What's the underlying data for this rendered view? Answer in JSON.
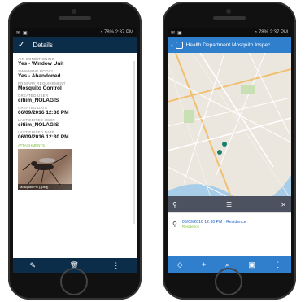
{
  "left_phone": {
    "status": {
      "time": "2:37 PM",
      "battery": "78%"
    },
    "header": {
      "title": "Details"
    },
    "fields": [
      {
        "label": "AIR CONDITIONING",
        "value": "Yes - Window Unit"
      },
      {
        "label": "SWIMMING POOL?",
        "value": "Yes - Abandoned"
      },
      {
        "label": "PRIMARY REQUIREMENT",
        "value": "Mosquito Control"
      },
      {
        "label": "CREATED USER",
        "value": "citiim_NOLAGIS"
      },
      {
        "label": "CREATED DATE",
        "value": "06/09/2016 12:30 PM"
      },
      {
        "label": "LAST EDITED USER",
        "value": "citiim_NOLAGIS"
      },
      {
        "label": "LAST EDITED DATE",
        "value": "06/09/2016 12:30 PM"
      }
    ],
    "attachments": {
      "label": "ATTACHMENTS",
      "caption": "Mosquito Pic (Jpeg)"
    }
  },
  "right_phone": {
    "status": {
      "time": "2:37 PM",
      "battery": "78%"
    },
    "header": {
      "title": "Health Department Mosquito Inspec..."
    },
    "popup": {
      "title": "06/09/2016 12:30 PM - Residence",
      "subtitle": "Residence"
    }
  },
  "colors": {
    "dark_navy": "#0b2d4a",
    "blue": "#2f7fcd",
    "green": "#7bbf3a"
  }
}
